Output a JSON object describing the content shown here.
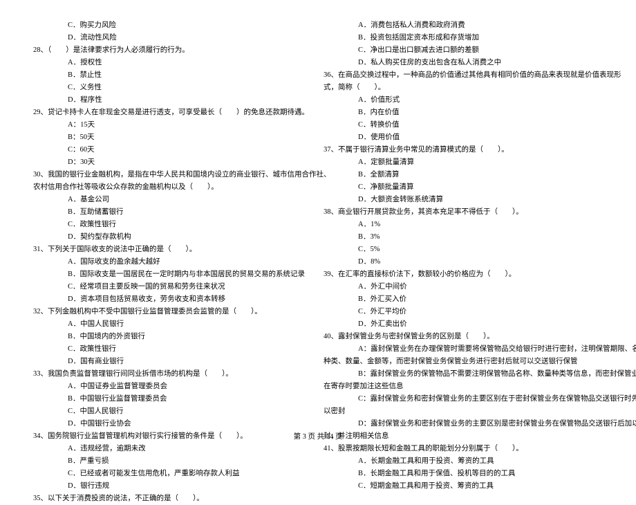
{
  "left_column": [
    {
      "cls": "opt-line",
      "text": "C．购买力风险"
    },
    {
      "cls": "opt-line",
      "text": "D．流动性风险"
    },
    {
      "cls": "q-line",
      "text": "28、（　　）是法律要求行为人必须履行的行为。"
    },
    {
      "cls": "opt-line",
      "text": "A．授权性"
    },
    {
      "cls": "opt-line",
      "text": "B．禁止性"
    },
    {
      "cls": "opt-line",
      "text": "C．义务性"
    },
    {
      "cls": "opt-line",
      "text": "D．程序性"
    },
    {
      "cls": "q-line",
      "text": "29、贷记卡持卡人在非现金交易是进行透支，可享受最长（　　）的免息还款期待遇。"
    },
    {
      "cls": "opt-line",
      "text": "A：15天"
    },
    {
      "cls": "opt-line",
      "text": "B：50天"
    },
    {
      "cls": "opt-line",
      "text": "C：60天"
    },
    {
      "cls": "opt-line",
      "text": "D：30天"
    },
    {
      "cls": "q-line",
      "text": "30、我国的银行业金融机构，是指在中华人民共和国境内设立的商业银行、城市信用合作社、"
    },
    {
      "cls": "q-line",
      "text": "农村信用合作社等吸收公众存款的金融机构以及（　　）。"
    },
    {
      "cls": "opt-line",
      "text": "A．基金公司"
    },
    {
      "cls": "opt-line",
      "text": "B．互助储蓄银行"
    },
    {
      "cls": "opt-line",
      "text": "C．政策性银行"
    },
    {
      "cls": "opt-line",
      "text": "D．契约型存款机构"
    },
    {
      "cls": "q-line",
      "text": "31、下列关于国际收支的说法中正确的是（　　）。"
    },
    {
      "cls": "opt-line",
      "text": "A．国际收支的盈余越大越好"
    },
    {
      "cls": "opt-line",
      "text": "B．国际收支是一国居民在一定时期内与非本国居民的贸易交易的系统记录"
    },
    {
      "cls": "opt-line",
      "text": "C．经常项目主要反映一国的贸易和劳务往来状况"
    },
    {
      "cls": "opt-line",
      "text": "D．资本项目包括贸易收支，劳务收支和资本转移"
    },
    {
      "cls": "q-line",
      "text": "32、下列金融机构中不受中国银行业监督管理委员会监管的是（　　）。"
    },
    {
      "cls": "opt-line",
      "text": "A．中国人民银行"
    },
    {
      "cls": "opt-line",
      "text": "B．中国境内的外资银行"
    },
    {
      "cls": "opt-line",
      "text": "C．政策性银行"
    },
    {
      "cls": "opt-line",
      "text": "D．国有商业银行"
    },
    {
      "cls": "q-line",
      "text": "33、我国负责监督管理银行间同业拆借市场的机构是（　　）。"
    },
    {
      "cls": "opt-line",
      "text": "A．中国证券业监督管理委员会"
    },
    {
      "cls": "opt-line",
      "text": "B．中国银行业监督管理委员会"
    },
    {
      "cls": "opt-line",
      "text": "C．中国人民银行"
    },
    {
      "cls": "opt-line",
      "text": "D．中国银行业协会"
    },
    {
      "cls": "q-line",
      "text": "34、国务院银行业监督管理机构对银行实行接管的条件是（　　）。"
    },
    {
      "cls": "opt-line",
      "text": "A．违规经营，逾期未改"
    },
    {
      "cls": "opt-line",
      "text": "B．严重亏损"
    },
    {
      "cls": "opt-line",
      "text": "C．已经或者可能发生信用危机，严重影响存款人利益"
    },
    {
      "cls": "opt-line",
      "text": "D．银行违规"
    },
    {
      "cls": "q-line",
      "text": "35、以下关于消费投资的说法，不正确的是（　　）。"
    }
  ],
  "right_column": [
    {
      "cls": "opt-line",
      "text": "A．消费包括私人消费和政府消费"
    },
    {
      "cls": "opt-line",
      "text": "B．投资包括固定资本形成和存货增加"
    },
    {
      "cls": "opt-line",
      "text": "C．净出口是出口额减去进口额的差额"
    },
    {
      "cls": "opt-line",
      "text": "D．私人购买住房的支出包含在私人消费之中"
    },
    {
      "cls": "q-line",
      "text": "36、在商品交换过程中，一种商品的价值通过其他具有相同价值的商品来表现就是价值表现形"
    },
    {
      "cls": "q-line",
      "text": "式，简称（　　）。"
    },
    {
      "cls": "opt-line",
      "text": "A．价值形式"
    },
    {
      "cls": "opt-line",
      "text": "B．内在价值"
    },
    {
      "cls": "opt-line",
      "text": "C．转换价值"
    },
    {
      "cls": "opt-line",
      "text": "D．使用价值"
    },
    {
      "cls": "q-line",
      "text": "37、不属于银行清算业务中常见的清算模式的是（　　）。"
    },
    {
      "cls": "opt-line",
      "text": "A．定额批量清算"
    },
    {
      "cls": "opt-line",
      "text": "B．全额清算"
    },
    {
      "cls": "opt-line",
      "text": "C．净额批量清算"
    },
    {
      "cls": "opt-line",
      "text": "D．大额资金转账系统清算"
    },
    {
      "cls": "q-line",
      "text": "38、商业银行开展贷款业务，其资本充足率不得低于（　　）。"
    },
    {
      "cls": "opt-line",
      "text": "A．1%"
    },
    {
      "cls": "opt-line",
      "text": "B．3%"
    },
    {
      "cls": "opt-line",
      "text": "C．5%"
    },
    {
      "cls": "opt-line",
      "text": "D．8%"
    },
    {
      "cls": "q-line",
      "text": "39、在汇率的直接标价法下，数额较小的价格应为（　　）。"
    },
    {
      "cls": "opt-line",
      "text": "A．外汇中间价"
    },
    {
      "cls": "opt-line",
      "text": "B．外汇买入价"
    },
    {
      "cls": "opt-line",
      "text": "C．外汇平均价"
    },
    {
      "cls": "opt-line",
      "text": "D．外汇卖出价"
    },
    {
      "cls": "q-line",
      "text": "40、露封保管业务与密封保管业务的区别是（　　）。"
    },
    {
      "cls": "opt-line",
      "text": "A：露封保管业务在办理保管时需要将保管物品交给银行时进行密封，注明保管期限、名称、"
    },
    {
      "cls": "q-line",
      "text": "种类、数量、金额等，而密封保管业务保管业务进行密封后就可以交送银行保管"
    },
    {
      "cls": "opt-line",
      "text": "B：露封保管业务的保管物品不需要注明保管物品名称、数量种类等信息，而密封保管业务"
    },
    {
      "cls": "q-line",
      "text": "在寄存时要加注这些信息"
    },
    {
      "cls": "opt-line",
      "text": "C：露封保管业务和密封保管业务的主要区别在于密封保管业务在保管物品交送银行时先加"
    },
    {
      "cls": "q-line",
      "text": "以密封"
    },
    {
      "cls": "opt-line",
      "text": "D：露封保管业务和密封保管业务的主要区别是密封保管业务在保管物品交送银行后加以密"
    },
    {
      "cls": "q-line",
      "text": "封，并注明相关信息"
    },
    {
      "cls": "q-line",
      "text": "41、股票按期限长短和金融工具的职能划分分别属于（　　）。"
    },
    {
      "cls": "opt-line",
      "text": "A．长期金融工具和用于投资、筹资的工具"
    },
    {
      "cls": "opt-line",
      "text": "B．长期金融工具和用于保值、投机等目的的工具"
    },
    {
      "cls": "opt-line",
      "text": "C．短期金融工具和用于投资、筹资的工具"
    }
  ],
  "footer": "第 3 页 共 14 页"
}
